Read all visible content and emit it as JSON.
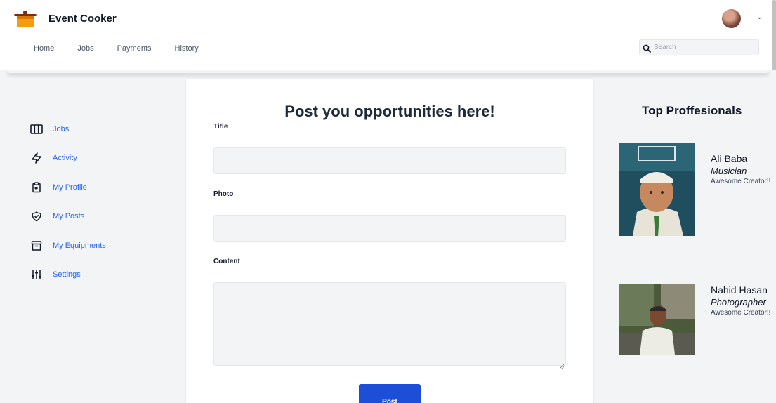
{
  "app": {
    "name": "Event Cooker"
  },
  "nav": {
    "items": [
      "Home",
      "Jobs",
      "Payments",
      "History"
    ]
  },
  "search": {
    "placeholder": "Search",
    "value": ""
  },
  "sidebar": {
    "items": [
      {
        "label": "Jobs",
        "icon": "columns-icon"
      },
      {
        "label": "Activity",
        "icon": "activity-icon"
      },
      {
        "label": "My Profile",
        "icon": "profile-clipboard-icon"
      },
      {
        "label": "My Posts",
        "icon": "shield-check-icon"
      },
      {
        "label": "My Equipments",
        "icon": "archive-icon"
      },
      {
        "label": "Settings",
        "icon": "sliders-icon"
      }
    ]
  },
  "form": {
    "title": "Post you opportunities here!",
    "fields": {
      "title_label": "Title",
      "photo_label": "Photo",
      "content_label": "Content"
    },
    "submit_label": "Post"
  },
  "professionals": {
    "heading": "Top Proffesionals",
    "items": [
      {
        "name": "Ali Baba",
        "role": "Musician",
        "description": "Awesome Creator!!"
      },
      {
        "name": "Nahid Hasan",
        "role": "Photographer",
        "description": "Awesome Creator!!"
      }
    ]
  },
  "colors": {
    "accent": "#2563eb",
    "button": "#1d4ed8",
    "field_bg": "#f3f4f6",
    "page_bg": "#f3f4f6"
  }
}
